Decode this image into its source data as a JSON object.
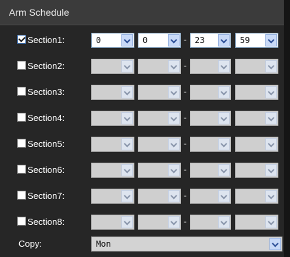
{
  "window": {
    "title": "Arm Schedule"
  },
  "sections": [
    {
      "label": "Section1:",
      "checked": true,
      "start_hour": "0",
      "start_min": "0",
      "end_hour": "23",
      "end_min": "59"
    },
    {
      "label": "Section2:",
      "checked": false,
      "start_hour": "",
      "start_min": "",
      "end_hour": "",
      "end_min": ""
    },
    {
      "label": "Section3:",
      "checked": false,
      "start_hour": "",
      "start_min": "",
      "end_hour": "",
      "end_min": ""
    },
    {
      "label": "Section4:",
      "checked": false,
      "start_hour": "",
      "start_min": "",
      "end_hour": "",
      "end_min": ""
    },
    {
      "label": "Section5:",
      "checked": false,
      "start_hour": "",
      "start_min": "",
      "end_hour": "",
      "end_min": ""
    },
    {
      "label": "Section6:",
      "checked": false,
      "start_hour": "",
      "start_min": "",
      "end_hour": "",
      "end_min": ""
    },
    {
      "label": "Section7:",
      "checked": false,
      "start_hour": "",
      "start_min": "",
      "end_hour": "",
      "end_min": ""
    },
    {
      "label": "Section8:",
      "checked": false,
      "start_hour": "",
      "start_min": "",
      "end_hour": "",
      "end_min": ""
    }
  ],
  "separator": "-",
  "copy": {
    "label": "Copy:",
    "value": "Mon"
  },
  "colors": {
    "background": "#262626",
    "titlebar": "#3b3b3b",
    "text": "#ffffff",
    "arrow_active": "#c8d9f7"
  }
}
